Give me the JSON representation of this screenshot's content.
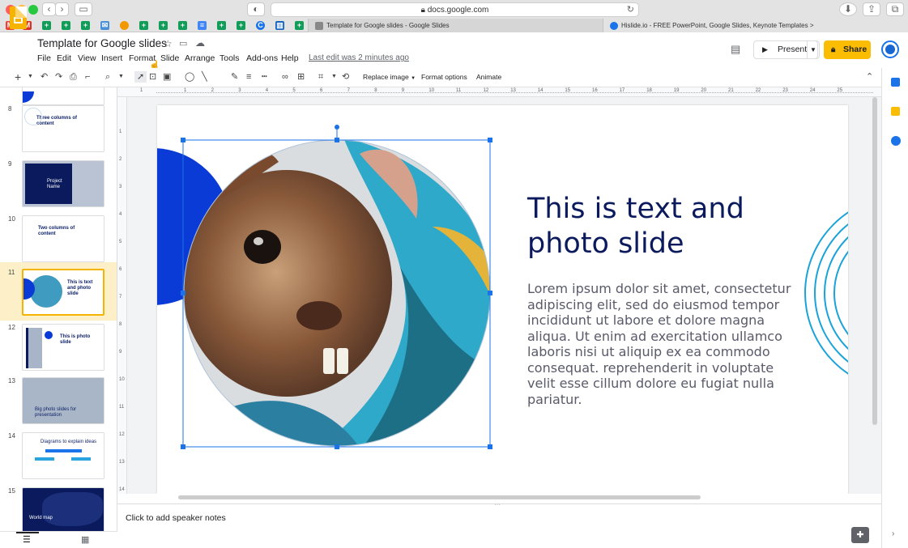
{
  "browser": {
    "url": "docs.google.com",
    "tabs": [
      {
        "label": "Template for Google slides - Google Slides"
      },
      {
        "label": "Hislide.io - FREE PowerPoint, Google Slides, Keynote Templates >"
      }
    ]
  },
  "doc": {
    "title": "Template for Google slides",
    "last_edit": "Last edit was 2 minutes ago"
  },
  "menu": [
    "File",
    "Edit",
    "View",
    "Insert",
    "Format",
    "Slide",
    "Arrange",
    "Tools",
    "Add-ons",
    "Help"
  ],
  "actions": {
    "present": "Present",
    "share": "Share"
  },
  "toolbar": {
    "replace_image": "Replace image",
    "format_options": "Format options",
    "animate": "Animate"
  },
  "ruler": {
    "top": [
      "1",
      "1",
      "2",
      "3",
      "4",
      "5",
      "6",
      "7",
      "8",
      "9",
      "10",
      "11",
      "12",
      "13",
      "14",
      "15",
      "16",
      "17",
      "18",
      "19",
      "20",
      "21",
      "22",
      "23",
      "24",
      "25"
    ],
    "left": [
      "1",
      "2",
      "3",
      "4",
      "5",
      "6",
      "7",
      "8",
      "9",
      "10",
      "11",
      "12",
      "13",
      "14"
    ]
  },
  "filmstrip": [
    {
      "num": "8",
      "text": "Three columns of content"
    },
    {
      "num": "9",
      "text": "Project Name"
    },
    {
      "num": "10",
      "text": "Two columns of content"
    },
    {
      "num": "11",
      "text": "This is text and photo slide",
      "selected": true
    },
    {
      "num": "12",
      "text": "This is photo slide"
    },
    {
      "num": "13",
      "text": "Big photo slides for presentation"
    },
    {
      "num": "14",
      "text": "Diagrams to explain ideas"
    },
    {
      "num": "15",
      "text": "World map"
    }
  ],
  "slide": {
    "title": "This is text and photo slide",
    "body": "Lorem ipsum dolor sit amet, consectetur adipiscing elit, sed do eiusmod tempor incididunt ut labore et dolore magna aliqua. Ut enim ad exercitation ullamco laboris nisi ut aliquip ex ea commodo consequat. reprehenderit in voluptate velit esse cillum dolore eu fugiat nulla pariatur."
  },
  "notes": {
    "placeholder": "Click to add speaker notes"
  },
  "colors": {
    "accent": "#1a73e8",
    "share": "#fbbc04",
    "slide_blue": "#0b3bd6",
    "title_navy": "#0a1a5c",
    "arc_cyan": "#1aa3d9"
  }
}
